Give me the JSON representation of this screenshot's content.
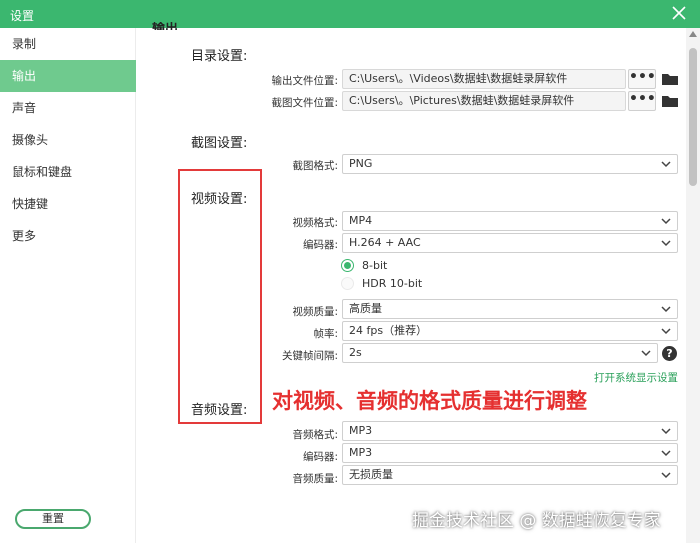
{
  "window": {
    "title": "设置"
  },
  "sidebar": {
    "items": [
      {
        "label": "录制",
        "active": false
      },
      {
        "label": "输出",
        "active": true
      },
      {
        "label": "声音",
        "active": false
      },
      {
        "label": "摄像头",
        "active": false
      },
      {
        "label": "鼠标和键盘",
        "active": false
      },
      {
        "label": "快捷键",
        "active": false
      },
      {
        "label": "更多",
        "active": false
      }
    ],
    "reset_label": "重置"
  },
  "main": {
    "partial_header": "输出",
    "directory": {
      "title": "目录设置:",
      "output_label": "输出文件位置:",
      "output_path": "C:\\Users\\。\\Videos\\数据蛙\\数据蛙录屏软件",
      "screenshot_label": "截图文件位置:",
      "screenshot_path": "C:\\Users\\。\\Pictures\\数据蛙\\数据蛙录屏软件",
      "browse_label": "•••"
    },
    "screenshot": {
      "title": "截图设置:",
      "format_label": "截图格式:",
      "format_value": "PNG"
    },
    "video": {
      "title": "视频设置:",
      "format_label": "视频格式:",
      "format_value": "MP4",
      "encoder_label": "编码器:",
      "encoder_value": "H.264 + AAC",
      "bit_8_label": "8-bit",
      "hdr_label": "HDR 10-bit",
      "quality_label": "视频质量:",
      "quality_value": "高质量",
      "fps_label": "帧率:",
      "fps_value": "24 fps（推荐）",
      "keyframe_label": "关键帧间隔:",
      "keyframe_value": "2s",
      "help_label": "?",
      "display_link": "打开系统显示设置"
    },
    "audio": {
      "title": "音频设置:",
      "format_label": "音频格式:",
      "format_value": "MP3",
      "encoder_label": "编码器:",
      "encoder_value": "MP3",
      "quality_label": "音频质量:",
      "quality_value": "无损质量"
    }
  },
  "annotation": {
    "text": "对视频、音频的格式质量进行调整"
  },
  "watermark": {
    "text": "掘金技术社区 @ 数据蛙恢复专家"
  },
  "colors": {
    "accent": "#3bb76f",
    "sidebar_active": "#6fca8e",
    "annotation": "#e53030",
    "link": "#2aa05a"
  }
}
